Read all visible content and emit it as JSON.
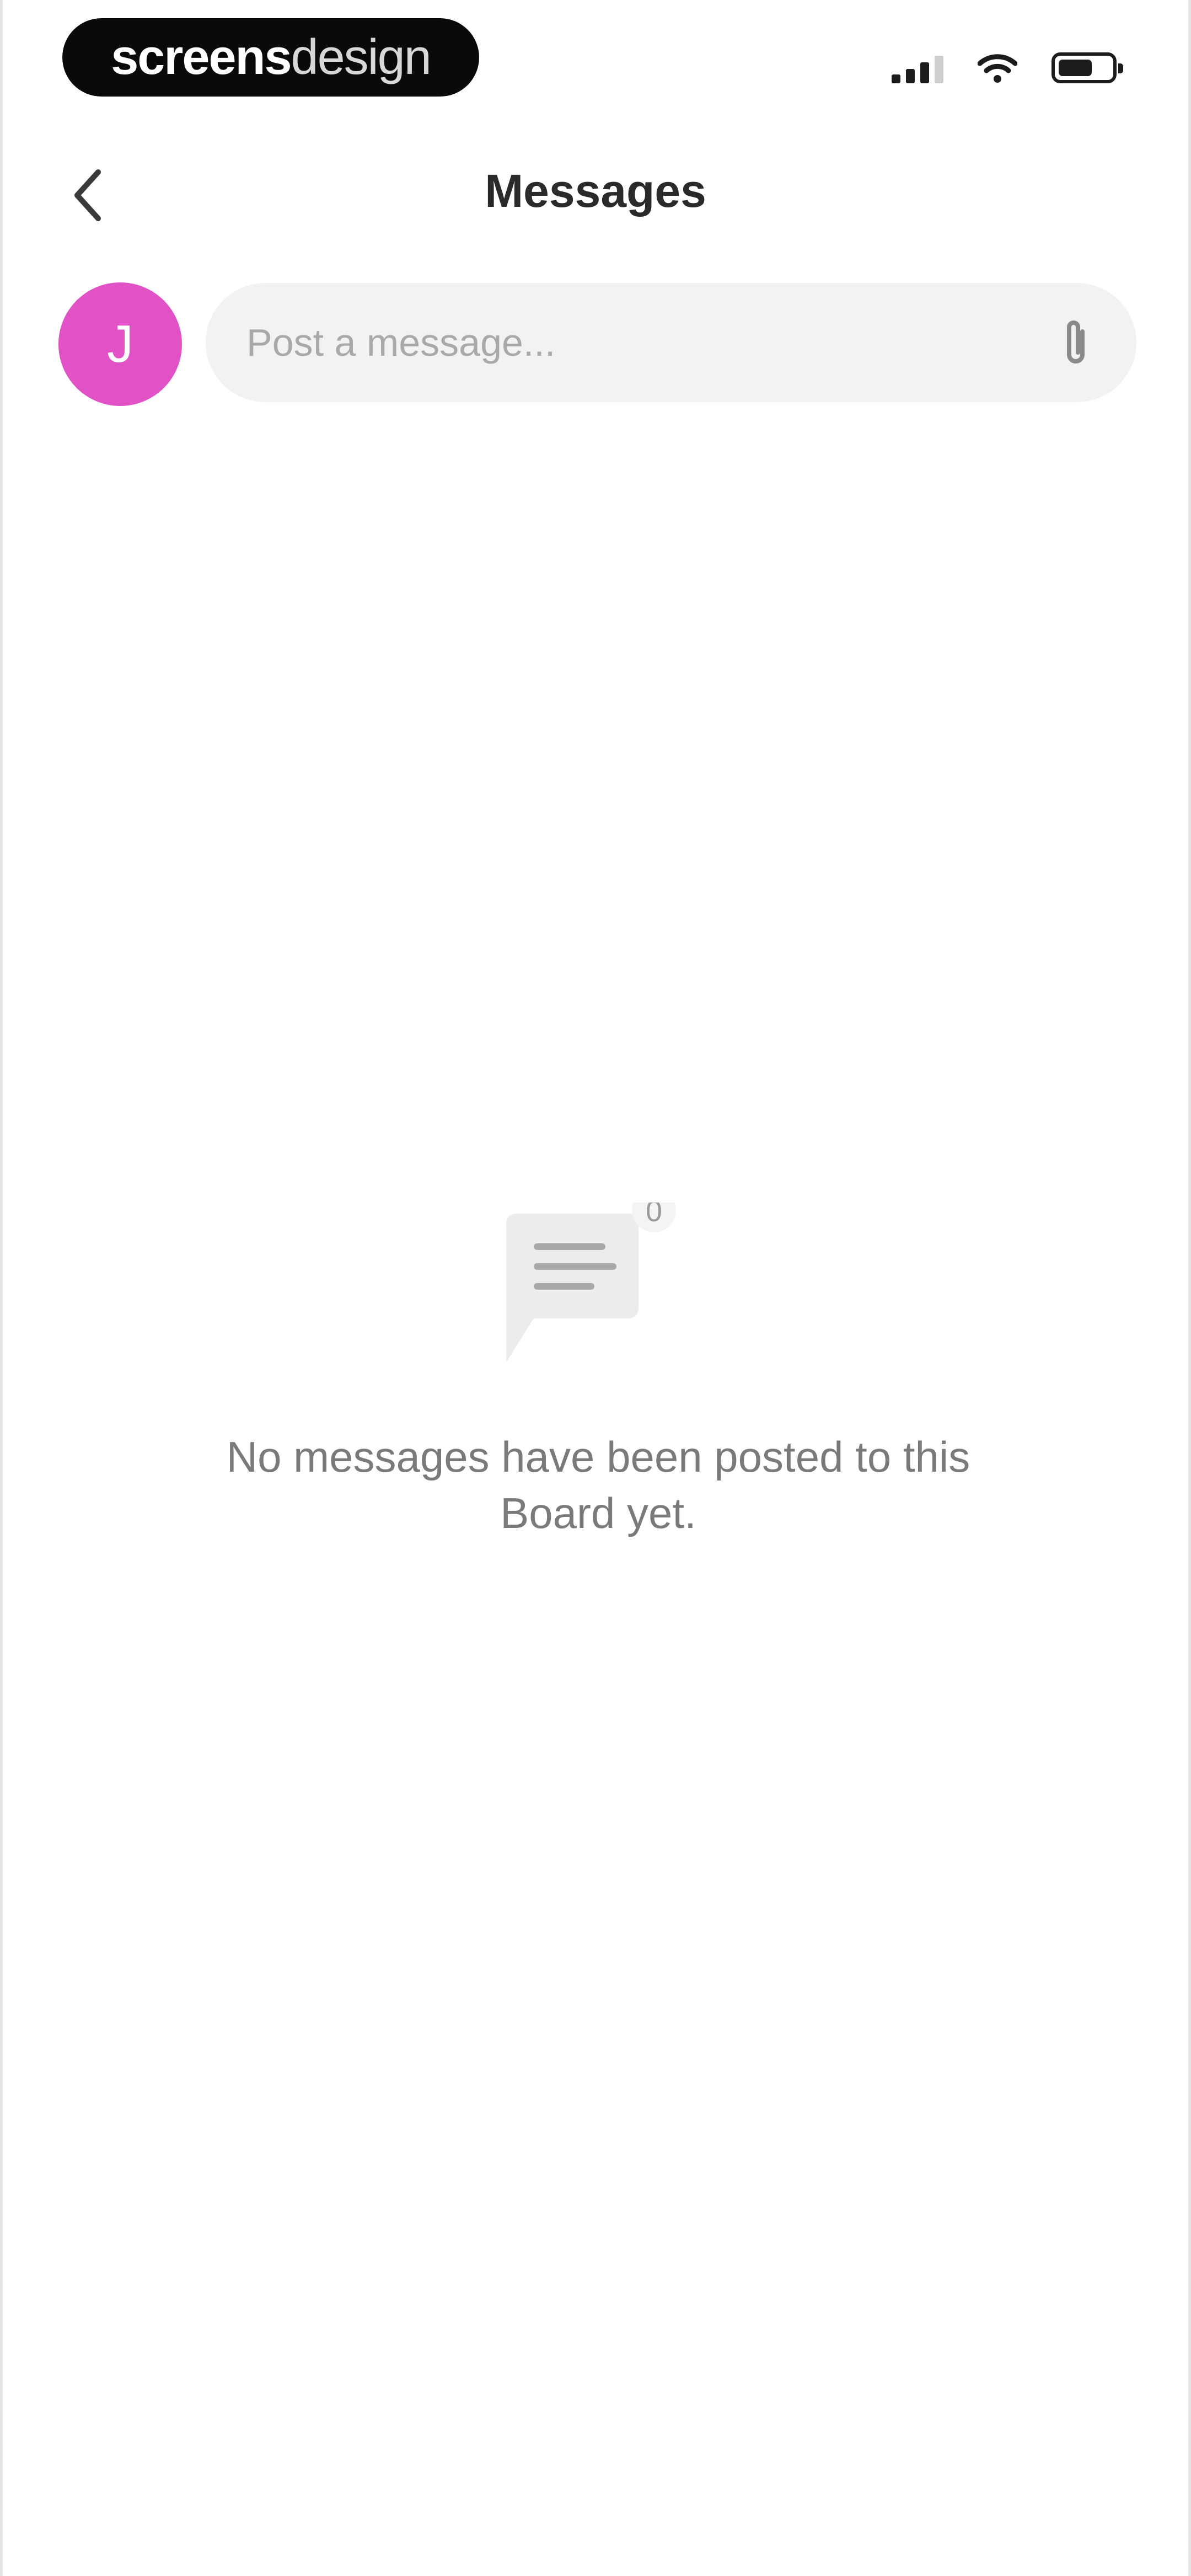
{
  "status_bar": {
    "brand_bold": "screens",
    "brand_light": "design",
    "signal_icon": "cellular-signal-icon",
    "wifi_icon": "wifi-icon",
    "battery_icon": "battery-icon",
    "battery_level": 0.65
  },
  "nav": {
    "back_icon": "chevron-left-icon",
    "title": "Messages"
  },
  "composer": {
    "avatar_initial": "J",
    "avatar_color": "#e052c6",
    "placeholder": "Post a message...",
    "input_value": "",
    "attach_icon": "paperclip-icon"
  },
  "empty_state": {
    "icon": "chat-bubble-icon",
    "badge_count": "0",
    "message": "No messages have been posted to this Board yet."
  },
  "colors": {
    "accent": "#e052c6",
    "input_background": "#f2f2f2",
    "muted_text": "#7a7a7a"
  }
}
